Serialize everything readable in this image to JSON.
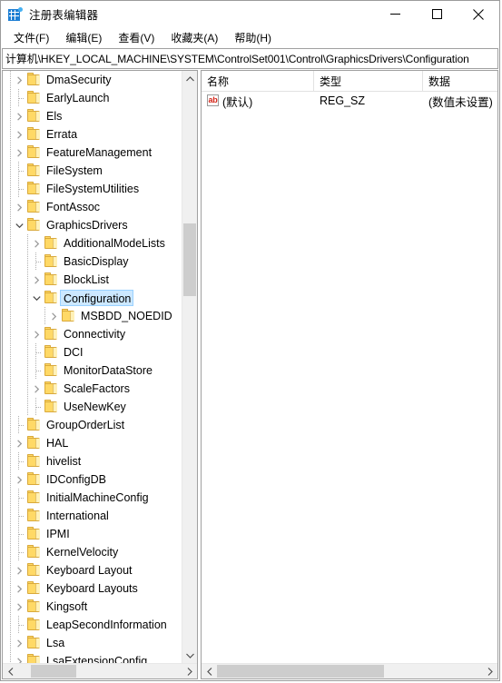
{
  "window": {
    "title": "注册表编辑器",
    "icon": "registry-editor-icon",
    "minimize_label": "最小化",
    "maximize_label": "最大化",
    "close_label": "关闭"
  },
  "menubar": {
    "items": [
      {
        "label": "文件(F)"
      },
      {
        "label": "编辑(E)"
      },
      {
        "label": "查看(V)"
      },
      {
        "label": "收藏夹(A)"
      },
      {
        "label": "帮助(H)"
      }
    ]
  },
  "address": {
    "value": "计算机\\HKEY_LOCAL_MACHINE\\SYSTEM\\ControlSet001\\Control\\GraphicsDrivers\\Configuration",
    "placeholder": ""
  },
  "tree": {
    "items": [
      {
        "label": "DmaSecurity",
        "depth": 1,
        "twisty": "collapsed",
        "selected": false
      },
      {
        "label": "EarlyLaunch",
        "depth": 1,
        "twisty": "none",
        "selected": false
      },
      {
        "label": "Els",
        "depth": 1,
        "twisty": "collapsed",
        "selected": false
      },
      {
        "label": "Errata",
        "depth": 1,
        "twisty": "collapsed",
        "selected": false
      },
      {
        "label": "FeatureManagement",
        "depth": 1,
        "twisty": "collapsed",
        "selected": false
      },
      {
        "label": "FileSystem",
        "depth": 1,
        "twisty": "none",
        "selected": false
      },
      {
        "label": "FileSystemUtilities",
        "depth": 1,
        "twisty": "none",
        "selected": false
      },
      {
        "label": "FontAssoc",
        "depth": 1,
        "twisty": "collapsed",
        "selected": false
      },
      {
        "label": "GraphicsDrivers",
        "depth": 1,
        "twisty": "expanded",
        "selected": false
      },
      {
        "label": "AdditionalModeLists",
        "depth": 2,
        "twisty": "collapsed",
        "selected": false
      },
      {
        "label": "BasicDisplay",
        "depth": 2,
        "twisty": "none",
        "selected": false
      },
      {
        "label": "BlockList",
        "depth": 2,
        "twisty": "collapsed",
        "selected": false
      },
      {
        "label": "Configuration",
        "depth": 2,
        "twisty": "expanded",
        "selected": true
      },
      {
        "label": "MSBDD_NOEDID",
        "depth": 3,
        "twisty": "collapsed",
        "selected": false
      },
      {
        "label": "Connectivity",
        "depth": 2,
        "twisty": "collapsed",
        "selected": false
      },
      {
        "label": "DCI",
        "depth": 2,
        "twisty": "none",
        "selected": false
      },
      {
        "label": "MonitorDataStore",
        "depth": 2,
        "twisty": "none",
        "selected": false
      },
      {
        "label": "ScaleFactors",
        "depth": 2,
        "twisty": "collapsed",
        "selected": false
      },
      {
        "label": "UseNewKey",
        "depth": 2,
        "twisty": "none",
        "selected": false
      },
      {
        "label": "GroupOrderList",
        "depth": 1,
        "twisty": "none",
        "selected": false
      },
      {
        "label": "HAL",
        "depth": 1,
        "twisty": "collapsed",
        "selected": false
      },
      {
        "label": "hivelist",
        "depth": 1,
        "twisty": "none",
        "selected": false
      },
      {
        "label": "IDConfigDB",
        "depth": 1,
        "twisty": "collapsed",
        "selected": false
      },
      {
        "label": "InitialMachineConfig",
        "depth": 1,
        "twisty": "none",
        "selected": false
      },
      {
        "label": "International",
        "depth": 1,
        "twisty": "none",
        "selected": false
      },
      {
        "label": "IPMI",
        "depth": 1,
        "twisty": "none",
        "selected": false
      },
      {
        "label": "KernelVelocity",
        "depth": 1,
        "twisty": "none",
        "selected": false
      },
      {
        "label": "Keyboard Layout",
        "depth": 1,
        "twisty": "collapsed",
        "selected": false
      },
      {
        "label": "Keyboard Layouts",
        "depth": 1,
        "twisty": "collapsed",
        "selected": false
      },
      {
        "label": "Kingsoft",
        "depth": 1,
        "twisty": "collapsed",
        "selected": false
      },
      {
        "label": "LeapSecondInformation",
        "depth": 1,
        "twisty": "none",
        "selected": false
      },
      {
        "label": "Lsa",
        "depth": 1,
        "twisty": "collapsed",
        "selected": false
      },
      {
        "label": "LsaExtensionConfig",
        "depth": 1,
        "twisty": "collapsed",
        "selected": false
      }
    ]
  },
  "list": {
    "columns": [
      {
        "label": "名称"
      },
      {
        "label": "类型"
      },
      {
        "label": "数据"
      }
    ],
    "rows": [
      {
        "icon": "ab-string-icon",
        "name": "(默认)",
        "type": "REG_SZ",
        "data": "(数值未设置)"
      }
    ]
  },
  "scrollbars": {
    "tree_vertical_up": "▲",
    "tree_vertical_down": "▼",
    "left": "‹",
    "right": "›"
  }
}
